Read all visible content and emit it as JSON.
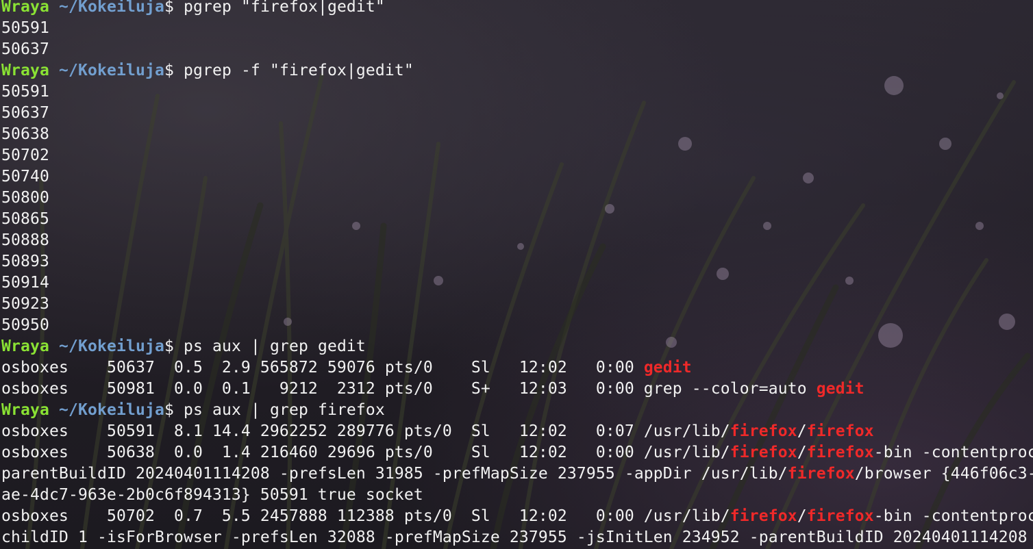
{
  "prompt": {
    "user": "Wraya",
    "path": "~/Kokeiluja",
    "symbol": "$"
  },
  "colors": {
    "user": "#8ae234",
    "path": "#729fcf",
    "text": "#f2f2f2",
    "match_highlight": "#ef2929"
  },
  "lines": [
    {
      "type": "prompt",
      "command": "pgrep \"firefox|gedit\""
    },
    {
      "type": "output",
      "segments": [
        {
          "text": "50591"
        }
      ]
    },
    {
      "type": "output",
      "segments": [
        {
          "text": "50637"
        }
      ]
    },
    {
      "type": "prompt",
      "command": "pgrep -f \"firefox|gedit\""
    },
    {
      "type": "output",
      "segments": [
        {
          "text": "50591"
        }
      ]
    },
    {
      "type": "output",
      "segments": [
        {
          "text": "50637"
        }
      ]
    },
    {
      "type": "output",
      "segments": [
        {
          "text": "50638"
        }
      ]
    },
    {
      "type": "output",
      "segments": [
        {
          "text": "50702"
        }
      ]
    },
    {
      "type": "output",
      "segments": [
        {
          "text": "50740"
        }
      ]
    },
    {
      "type": "output",
      "segments": [
        {
          "text": "50800"
        }
      ]
    },
    {
      "type": "output",
      "segments": [
        {
          "text": "50865"
        }
      ]
    },
    {
      "type": "output",
      "segments": [
        {
          "text": "50888"
        }
      ]
    },
    {
      "type": "output",
      "segments": [
        {
          "text": "50893"
        }
      ]
    },
    {
      "type": "output",
      "segments": [
        {
          "text": "50914"
        }
      ]
    },
    {
      "type": "output",
      "segments": [
        {
          "text": "50923"
        }
      ]
    },
    {
      "type": "output",
      "segments": [
        {
          "text": "50950"
        }
      ]
    },
    {
      "type": "prompt",
      "command": "ps aux | grep gedit"
    },
    {
      "type": "output",
      "segments": [
        {
          "text": "osboxes    50637  0.5  2.9 565872 59076 pts/0    Sl   12:02   0:00 "
        },
        {
          "text": "gedit",
          "hl": true
        }
      ]
    },
    {
      "type": "output",
      "segments": [
        {
          "text": "osboxes    50981  0.0  0.1   9212  2312 pts/0    S+   12:03   0:00 grep --color=auto "
        },
        {
          "text": "gedit",
          "hl": true
        }
      ]
    },
    {
      "type": "prompt",
      "command": "ps aux | grep firefox"
    },
    {
      "type": "output",
      "segments": [
        {
          "text": "osboxes    50591  8.1 14.4 2962252 289776 pts/0  Sl   12:02   0:07 /usr/lib/"
        },
        {
          "text": "firefox",
          "hl": true
        },
        {
          "text": "/"
        },
        {
          "text": "firefox",
          "hl": true
        }
      ]
    },
    {
      "type": "output",
      "segments": [
        {
          "text": "osboxes    50638  0.0  1.4 216460 29696 pts/0    Sl   12:02   0:00 /usr/lib/"
        },
        {
          "text": "firefox",
          "hl": true
        },
        {
          "text": "/"
        },
        {
          "text": "firefox",
          "hl": true
        },
        {
          "text": "-bin -contentproc"
        }
      ]
    },
    {
      "type": "output",
      "segments": [
        {
          "text": "parentBuildID 20240401114208 -prefsLen 31985 -prefMapSize 237955 -appDir /usr/lib/"
        },
        {
          "text": "firefox",
          "hl": true
        },
        {
          "text": "/browser {446f06c3-"
        }
      ]
    },
    {
      "type": "output",
      "segments": [
        {
          "text": "ae-4dc7-963e-2b0c6f894313} 50591 true socket"
        }
      ]
    },
    {
      "type": "output",
      "segments": [
        {
          "text": "osboxes    50702  0.7  5.5 2457888 112388 pts/0  Sl   12:02   0:00 /usr/lib/"
        },
        {
          "text": "firefox",
          "hl": true
        },
        {
          "text": "/"
        },
        {
          "text": "firefox",
          "hl": true
        },
        {
          "text": "-bin -contentproc"
        }
      ]
    },
    {
      "type": "output",
      "segments": [
        {
          "text": "childID 1 -isForBrowser -prefsLen 32088 -prefMapSize 237955 -jsInitLen 234952 -parentBuildID 20240401114208 -"
        }
      ]
    }
  ]
}
